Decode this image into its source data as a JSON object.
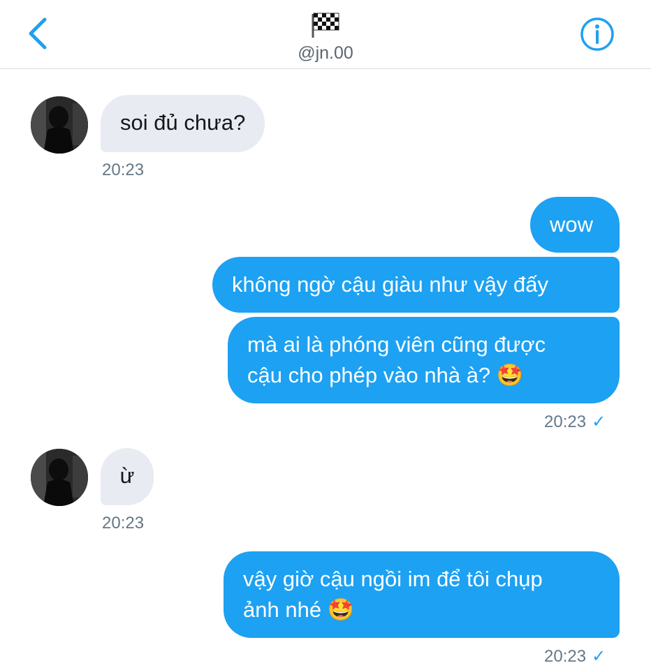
{
  "header": {
    "handle": "@jn.00",
    "back_icon": "chevron-left-icon",
    "info_icon": "info-icon",
    "flag_icon": "checkered-flag-icon"
  },
  "messages": [
    {
      "side": "in",
      "text": "soi đủ chưa?",
      "time": "20:23"
    },
    {
      "side": "out",
      "text": "wow"
    },
    {
      "side": "out",
      "text": "không ngờ cậu giàu như vậy đấy"
    },
    {
      "side": "out",
      "line1": "mà ai là phóng viên cũng được",
      "line2": "cậu cho phép vào nhà à?",
      "emoji": "🤩",
      "time": "20:23"
    },
    {
      "side": "in",
      "text": "ừ",
      "time": "20:23"
    },
    {
      "side": "out",
      "line1": "vậy giờ cậu ngồi im để tôi chụp",
      "line2": "ảnh nhé",
      "emoji": "🤩",
      "time": "20:23"
    }
  ],
  "colors": {
    "accent": "#1da1f2",
    "incoming_bubble": "#e8ebf2",
    "time_text": "#657786"
  },
  "status": {
    "read_mark": "✓"
  }
}
